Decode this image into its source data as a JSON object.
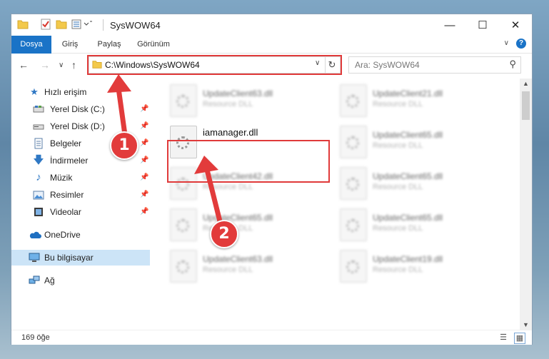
{
  "window": {
    "title": "SysWOW64"
  },
  "ribbon": {
    "tabs": [
      "Dosya",
      "Giriş",
      "Paylaş",
      "Görünüm"
    ]
  },
  "address": {
    "path": "C:\\Windows\\SysWOW64"
  },
  "search": {
    "placeholder": "Ara: SysWOW64"
  },
  "sidebar": {
    "items": [
      {
        "label": "Hızlı erişim",
        "icon": "star-icon"
      },
      {
        "label": "Yerel Disk (C:)",
        "icon": "drive-icon",
        "pinned": true
      },
      {
        "label": "Yerel Disk (D:)",
        "icon": "drive-icon",
        "pinned": true
      },
      {
        "label": "Belgeler",
        "icon": "documents-icon",
        "pinned": true
      },
      {
        "label": "İndirmeler",
        "icon": "download-icon",
        "pinned": true
      },
      {
        "label": "Müzik",
        "icon": "music-icon",
        "pinned": true
      },
      {
        "label": "Resimler",
        "icon": "pictures-icon",
        "pinned": true
      },
      {
        "label": "Videolar",
        "icon": "videos-icon",
        "pinned": true
      },
      {
        "label": "OneDrive",
        "icon": "cloud-icon"
      },
      {
        "label": "Bu bilgisayar",
        "icon": "computer-icon",
        "selected": true
      },
      {
        "label": "Ağ",
        "icon": "network-icon"
      }
    ]
  },
  "files": {
    "main": {
      "name": "iamanager.dll"
    },
    "blurred": [
      {
        "name": "UpdateClient63.dll",
        "desc": "Resource DLL"
      },
      {
        "name": "UpdateClient21.dll",
        "desc": "Resource DLL"
      },
      {
        "name": "UpdateClient65.dll",
        "desc": "Resource DLL"
      },
      {
        "name": "UpdateClient42.dll",
        "desc": "Resource DLL"
      },
      {
        "name": "UpdateClient65.dll",
        "desc": "Resource DLL"
      },
      {
        "name": "UpdateClient65.dll",
        "desc": "Resource DLL"
      },
      {
        "name": "UpdateClient65.dll",
        "desc": "Resource DLL"
      },
      {
        "name": "UpdateClient63.dll",
        "desc": "Resource DLL"
      },
      {
        "name": "UpdateClient19.dll",
        "desc": "Resource DLL"
      }
    ]
  },
  "status": {
    "count": "169 öğe"
  },
  "annotations": {
    "step1": "1",
    "step2": "2"
  },
  "colors": {
    "accent": "#1a73c7",
    "highlight": "#e03a3a",
    "selection": "#cce4f7"
  }
}
